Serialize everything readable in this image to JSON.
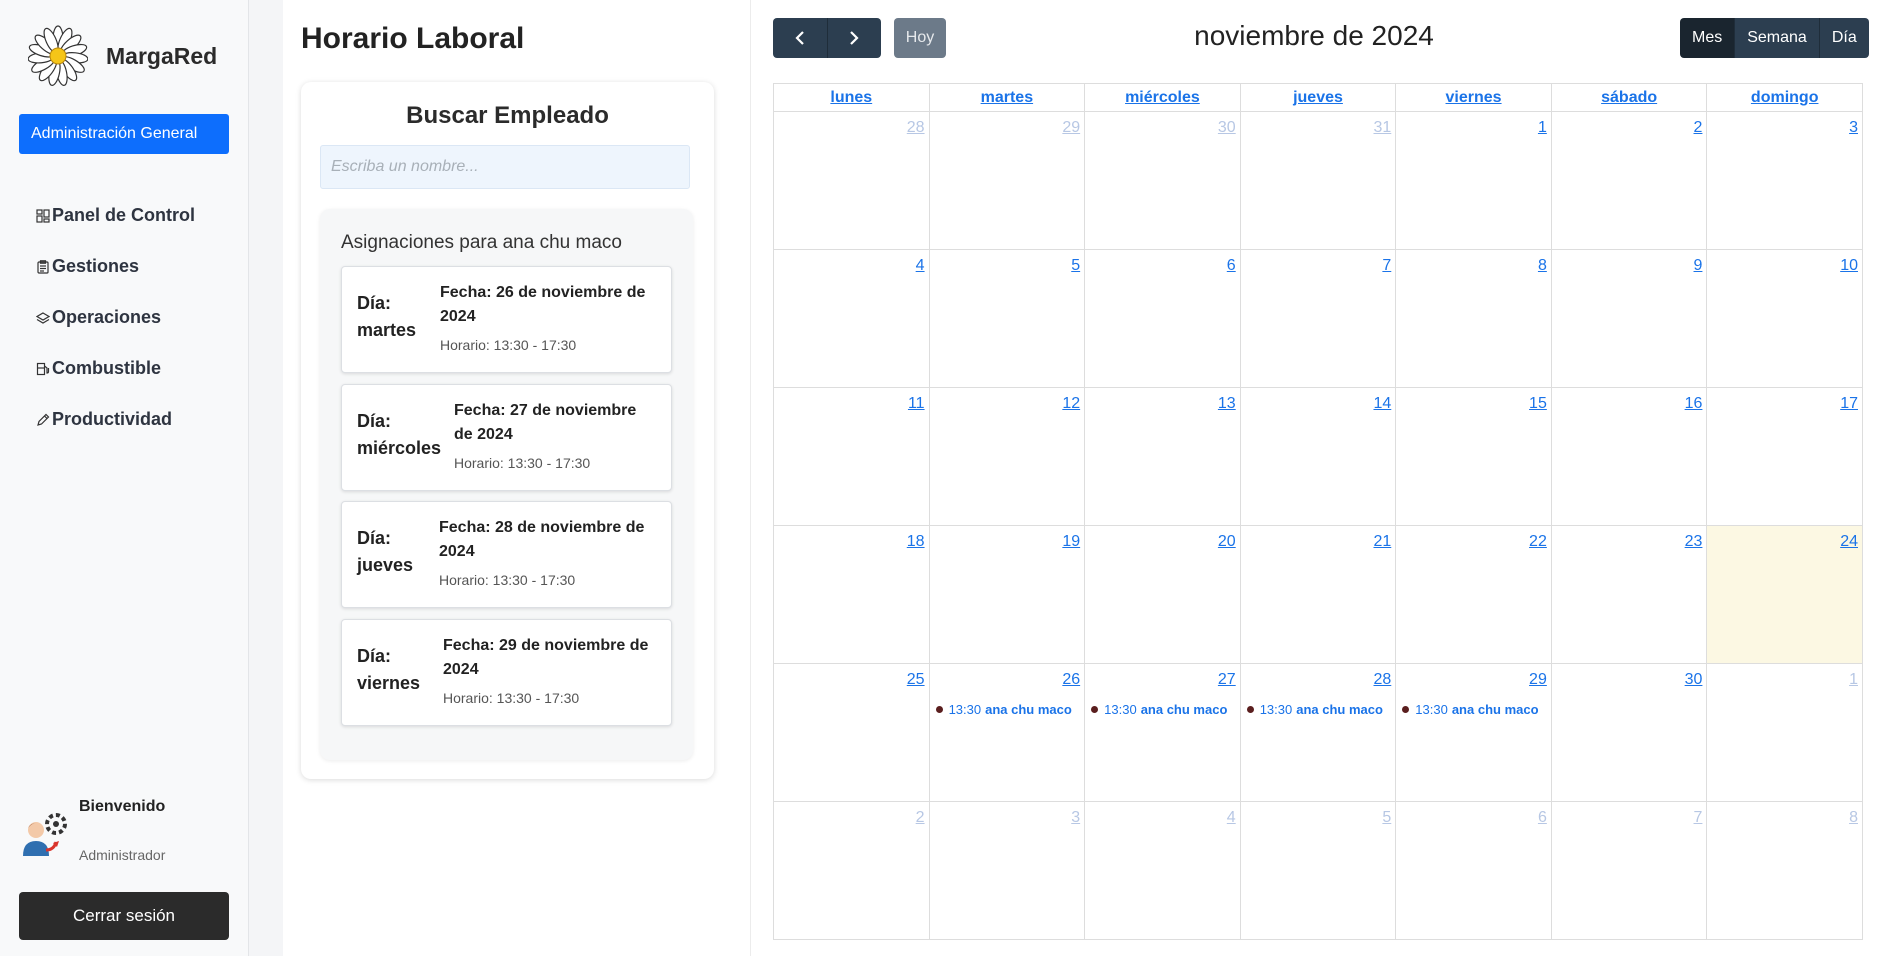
{
  "brand": {
    "name": "MargaRed"
  },
  "sidebar": {
    "admin_button": "Administración General",
    "items": [
      {
        "label": "Panel de Control",
        "icon": "dashboard-icon"
      },
      {
        "label": "Gestiones",
        "icon": "clipboard-icon"
      },
      {
        "label": "Operaciones",
        "icon": "layers-icon"
      },
      {
        "label": "Combustible",
        "icon": "fuel-icon"
      },
      {
        "label": "Productividad",
        "icon": "pencil-icon"
      }
    ],
    "welcome_title": "Bienvenido",
    "welcome_role": "Administrador",
    "logout_button": "Cerrar sesión"
  },
  "page": {
    "title": "Horario Laboral"
  },
  "search": {
    "title": "Buscar Empleado",
    "placeholder": "Escriba un nombre...",
    "assignments_title": "Asignaciones para ana chu maco",
    "assignments": [
      {
        "day": "Día: martes",
        "date": "Fecha: 26 de noviembre de 2024",
        "hours": "Horario: 13:30 - 17:30"
      },
      {
        "day": "Día: miércoles",
        "date": "Fecha: 27 de noviembre de 2024",
        "hours": "Horario: 13:30 - 17:30"
      },
      {
        "day": "Día: jueves",
        "date": "Fecha: 28 de noviembre de 2024",
        "hours": "Horario: 13:30 - 17:30"
      },
      {
        "day": "Día: viernes",
        "date": "Fecha: 29 de noviembre de 2024",
        "hours": "Horario: 13:30 - 17:30"
      }
    ]
  },
  "calendar": {
    "title": "noviembre de 2024",
    "today_button": "Hoy",
    "views": [
      "Mes",
      "Semana",
      "Día"
    ],
    "active_view": "Mes",
    "weekdays": [
      "lunes",
      "martes",
      "miércoles",
      "jueves",
      "viernes",
      "sábado",
      "domingo"
    ],
    "today": "24",
    "weeks": [
      [
        {
          "n": "28",
          "other": true
        },
        {
          "n": "29",
          "other": true
        },
        {
          "n": "30",
          "other": true
        },
        {
          "n": "31",
          "other": true
        },
        {
          "n": "1"
        },
        {
          "n": "2"
        },
        {
          "n": "3"
        }
      ],
      [
        {
          "n": "4"
        },
        {
          "n": "5"
        },
        {
          "n": "6"
        },
        {
          "n": "7"
        },
        {
          "n": "8"
        },
        {
          "n": "9"
        },
        {
          "n": "10"
        }
      ],
      [
        {
          "n": "11"
        },
        {
          "n": "12"
        },
        {
          "n": "13"
        },
        {
          "n": "14"
        },
        {
          "n": "15"
        },
        {
          "n": "16"
        },
        {
          "n": "17"
        }
      ],
      [
        {
          "n": "18"
        },
        {
          "n": "19"
        },
        {
          "n": "20"
        },
        {
          "n": "21"
        },
        {
          "n": "22"
        },
        {
          "n": "23"
        },
        {
          "n": "24",
          "today": true
        }
      ],
      [
        {
          "n": "25"
        },
        {
          "n": "26",
          "event": {
            "time": "13:30",
            "title": "ana chu maco"
          }
        },
        {
          "n": "27",
          "event": {
            "time": "13:30",
            "title": "ana chu maco"
          }
        },
        {
          "n": "28",
          "event": {
            "time": "13:30",
            "title": "ana chu maco"
          }
        },
        {
          "n": "29",
          "event": {
            "time": "13:30",
            "title": "ana chu maco"
          }
        },
        {
          "n": "30"
        },
        {
          "n": "1",
          "other": true
        }
      ],
      [
        {
          "n": "2",
          "other": true
        },
        {
          "n": "3",
          "other": true
        },
        {
          "n": "4",
          "other": true
        },
        {
          "n": "5",
          "other": true
        },
        {
          "n": "6",
          "other": true
        },
        {
          "n": "7",
          "other": true
        },
        {
          "n": "8",
          "other": true
        }
      ]
    ]
  },
  "colors": {
    "primary": "#0d6efd",
    "nav_dark": "#2c3e50",
    "today_bg": "#fcf8e3",
    "link": "#1a73e8"
  }
}
